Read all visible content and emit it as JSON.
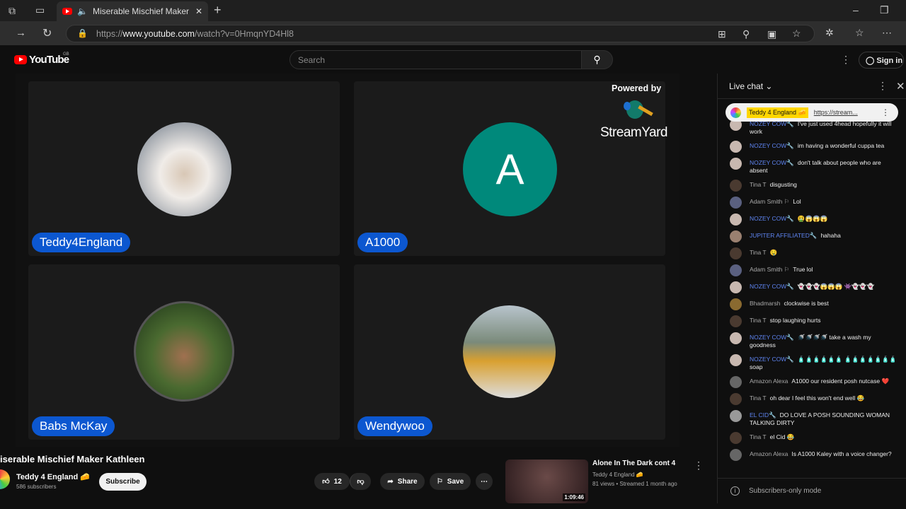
{
  "browser": {
    "tab_title": "Miserable Mischief Maker Ka",
    "url_prefix": "https://",
    "url_host": "www.youtube.com",
    "url_path": "/watch?v=0HmqnYD4Hl8"
  },
  "youtube": {
    "logo": "YouTube",
    "region": "GB",
    "search_placeholder": "Search",
    "sign_in": "Sign in"
  },
  "video": {
    "powered_by": "Powered by",
    "brand": "StreamYard",
    "participants": [
      {
        "name": "Teddy4England"
      },
      {
        "name": "A1000",
        "initial": "A"
      },
      {
        "name": "Babs McKay"
      },
      {
        "name": "Wendywoo"
      }
    ]
  },
  "below": {
    "title": "iserable Mischief Maker Kathleen",
    "channel": "Teddy 4 England 🧀",
    "subscribers": "586 subscribers",
    "subscribe": "Subscribe",
    "likes": "12",
    "share": "Share",
    "save": "Save"
  },
  "related": {
    "title": "Alone In The Dark cont 4",
    "channel": "Teddy 4 England 🧀",
    "meta": "81 views • Streamed 1 month ago",
    "duration": "1:09:46"
  },
  "chat": {
    "header": "Live chat",
    "pinned": {
      "author": "Teddy 4 England 🧀",
      "link": "https://stream..."
    },
    "messages": [
      {
        "author": "NOZEY COW🔧",
        "text": "I've just used 4head hopefully it will work",
        "mod": true
      },
      {
        "author": "NOZEY COW🔧",
        "text": "im having a wonderful cuppa tea",
        "mod": true
      },
      {
        "author": "NOZEY COW🔧",
        "text": "don't talk about people who are absent",
        "mod": true
      },
      {
        "author": "Tina T",
        "text": "disgusting"
      },
      {
        "author": "Adam Smith ⚐",
        "text": "Lol"
      },
      {
        "author": "NOZEY COW🔧",
        "text": "🤮😱😱😱",
        "mod": true
      },
      {
        "author": "JUPITER AFFILIATED🔧",
        "text": "hahaha",
        "mod": true
      },
      {
        "author": "Tina T",
        "text": "🤤"
      },
      {
        "author": "Adam Smith ⚐",
        "text": "True lol"
      },
      {
        "author": "NOZEY COW🔧",
        "text": "👻👻👻😱😱😱 👾👻👻👻",
        "mod": true
      },
      {
        "author": "Bhadmarsh",
        "text": "clockwise is best"
      },
      {
        "author": "Tina T",
        "text": "stop laughing hurts"
      },
      {
        "author": "NOZEY COW🔧",
        "text": "🚿🚿🚿🚿 take a wash my goodness",
        "mod": true
      },
      {
        "author": "NOZEY COW🔧",
        "text": "🧴🧴🧴🧴🧴🧴 🧴🧴🧴🧴🧴🧴🧴 soap",
        "mod": true
      },
      {
        "author": "Amazon Alexa",
        "text": "A1000 our resident posh nutcase ❤️"
      },
      {
        "author": "Tina T",
        "text": "oh dear I feel this won't end well 😂"
      },
      {
        "author": "EL CID🔧",
        "text": "DO LOVE A POSH SOUNDING WOMAN TALKING DIRTY",
        "mod": true
      },
      {
        "author": "Tina T",
        "text": "el Cid 😂"
      },
      {
        "author": "Amazon Alexa",
        "text": "Is A1000 Kaley with a voice changer?"
      }
    ],
    "footer": "Subscribers-only mode"
  },
  "colors": {
    "accent": "#0c57d0",
    "mod": "#5e84f1",
    "youtube_red": "#ff0000",
    "a1000_avatar": "#00897b"
  }
}
